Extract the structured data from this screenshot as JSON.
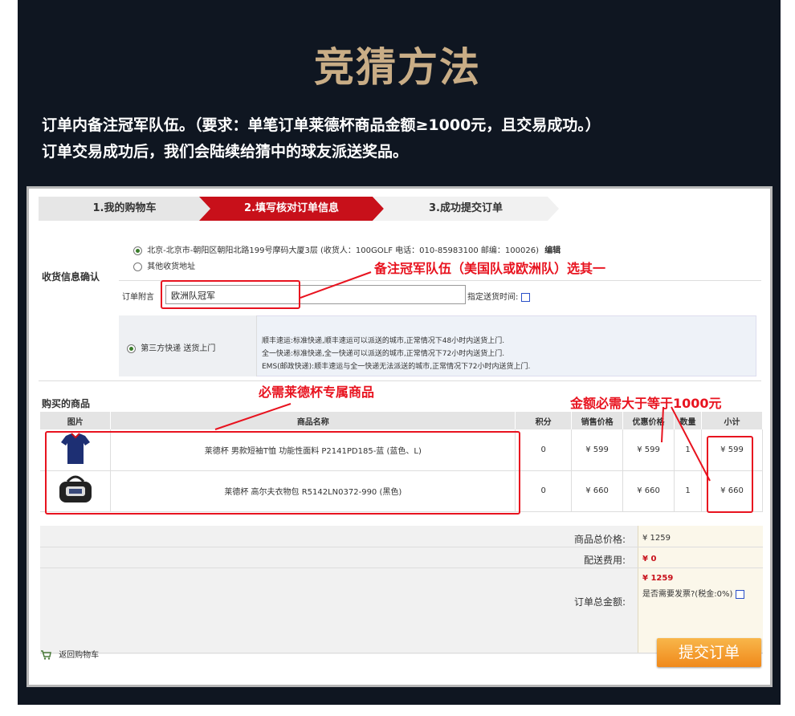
{
  "header": {
    "title": "竞猜方法",
    "line1": "订单内备注冠军队伍。（要求：单笔订单莱德杯商品金额≥1000元，且交易成功。）",
    "line2": "订单交易成功后，我们会陆续给猜中的球友派送奖品。"
  },
  "steps": [
    "1.我的购物车",
    "2.填写核对订单信息",
    "3.成功提交订单"
  ],
  "shipping": {
    "section_label": "收货信息确认",
    "address": "北京-北京市-朝阳区朝阳北路199号摩码大厦3层 (收货人：100GOLF 电话：010-85983100 邮编：100026)",
    "edit_label": "编辑",
    "other_address": "其他收货地址",
    "note_label": "订单附言",
    "note_value": "欧洲队冠军",
    "delivery_time_label": "指定送货时间:",
    "method_label": "第三方快递 送货上门",
    "method_desc": [
      "顺丰速运:标准快递,顺丰速运可以派送的城市,正常情况下48小时内送货上门.",
      "全一快递:标准快递,全一快递可以派送的城市,正常情况下72小时内送货上门.",
      "EMS(邮政快递):顺丰速运与全一快递无法派送的城市,正常情况下72小时内送货上门."
    ]
  },
  "annotations": {
    "note": "备注冠军队伍（美国队或欧洲队）选其一",
    "goods": "必需莱德杯专属商品",
    "amount": "金额必需大于等于1000元"
  },
  "goods": {
    "section_label": "购买的商品",
    "headers": [
      "图片",
      "商品名称",
      "积分",
      "销售价格",
      "优惠价格",
      "数量",
      "小计"
    ],
    "rows": [
      {
        "image_icon": "polo-shirt-icon",
        "name": "莱德杯 男款短袖T恤 功能性面料 P2141PD185-蓝 (蓝色、L)",
        "points": "0",
        "price": "¥ 599",
        "discount": "¥ 599",
        "qty": "1",
        "subtotal": "¥ 599"
      },
      {
        "image_icon": "golf-bag-icon",
        "name": "莱德杯 高尔夫衣物包 R5142LN0372-990 (黑色)",
        "points": "0",
        "price": "¥ 660",
        "discount": "¥ 660",
        "qty": "1",
        "subtotal": "¥ 660"
      }
    ]
  },
  "summary": {
    "goods_total_label": "商品总价格:",
    "goods_total": "¥ 1259",
    "shipping_label": "配送费用:",
    "shipping": "¥ 0",
    "order_total_label": "订单总金额:",
    "order_total": "¥ 1259",
    "invoice_label": "是否需要发票?(税金:0%)"
  },
  "footer": {
    "back_label": "返回购物车",
    "submit_label": "提交订单"
  },
  "colors": {
    "accent_red": "#e8131f",
    "step_red": "#c8101a",
    "submit_orange": "#f39a1c",
    "title_gold": "#c9ad86"
  }
}
